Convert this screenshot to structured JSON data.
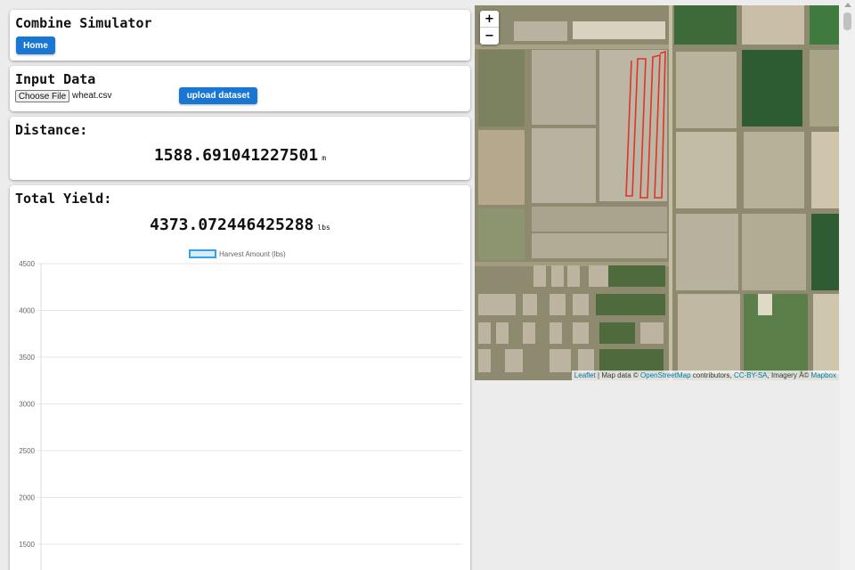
{
  "app": {
    "title": "Combine Simulator",
    "home_label": "Home"
  },
  "input": {
    "heading": "Input Data",
    "file_button_label": "Choose File",
    "file_name": "wheat.csv",
    "upload_label": "upload dataset"
  },
  "distance": {
    "heading": "Distance:",
    "value": "1588.691041227501",
    "unit": "m"
  },
  "yield": {
    "heading": "Total Yield:",
    "value": "4373.072446425288",
    "unit": "lbs"
  },
  "chart_data": {
    "type": "bar",
    "series": [
      {
        "name": "Harvest Amount (lbs)",
        "values": []
      }
    ],
    "y_ticks": [
      4500,
      4000,
      3500,
      3000,
      2500,
      2000,
      1500
    ],
    "ylim": [
      1500,
      4500
    ],
    "grid": true,
    "legend_position": "top",
    "colors": {
      "legend_border": "#36a2eb",
      "legend_fill": "#d7ecfb",
      "grid": "#e5e5e5"
    }
  },
  "map": {
    "zoom_in": "+",
    "zoom_out": "−",
    "attribution": {
      "leaflet": "Leaflet",
      "sep1": " | Map data © ",
      "osm": "OpenStreetMap",
      "sep2": " contributors, ",
      "license": "CC-BY-SA",
      "sep3": ", Imagery Â© ",
      "provider": "Mapbox"
    },
    "path_color": "#e0332b"
  },
  "colors": {
    "primary_button": "#1976d2"
  }
}
